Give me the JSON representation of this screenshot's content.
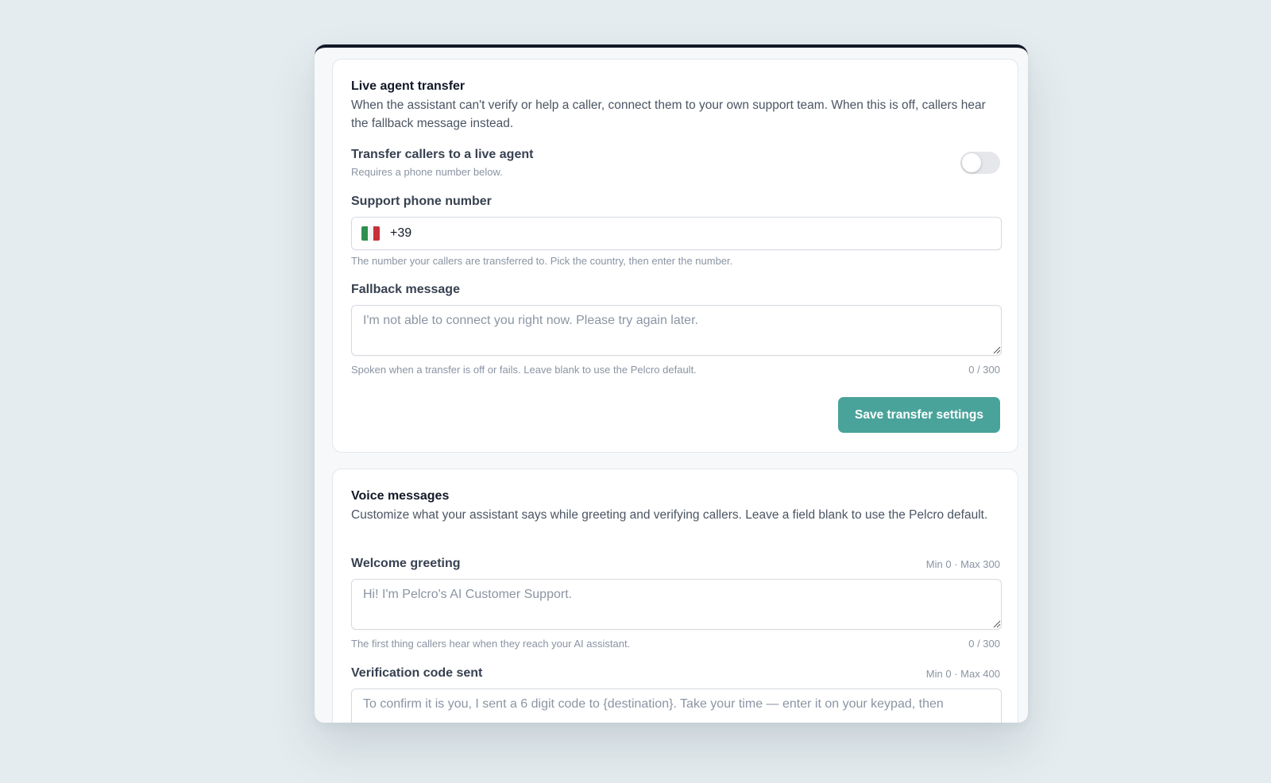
{
  "transfer": {
    "title": "Live agent transfer",
    "description": "When the assistant can't verify or help a caller, connect them to your own support team. When this is off, callers hear the fallback message instead.",
    "toggle_label": "Transfer callers to a live agent",
    "toggle_sublabel": "Requires a phone number below.",
    "toggle_on": false,
    "phone_label": "Support phone number",
    "phone_country": "Italy",
    "phone_value": "+39",
    "phone_helper": "The number your callers are transferred to. Pick the country, then enter the number.",
    "fallback_label": "Fallback message",
    "fallback_placeholder": "I'm not able to connect you right now. Please try again later.",
    "fallback_helper": "Spoken when a transfer is off or fails. Leave blank to use the Pelcro default.",
    "fallback_counter": "0 / 300",
    "save_label": "Save transfer settings"
  },
  "voice": {
    "title": "Voice messages",
    "description": "Customize what your assistant says while greeting and verifying callers. Leave a field blank to use the Pelcro default.",
    "welcome_label": "Welcome greeting",
    "welcome_limits": "Min 0 · Max 300",
    "welcome_placeholder": "Hi! I'm Pelcro's AI Customer Support.",
    "welcome_helper": "The first thing callers hear when they reach your AI assistant.",
    "welcome_counter": "0 / 300",
    "verification_label": "Verification code sent",
    "verification_limits": "Min 0 · Max 400",
    "verification_placeholder": "To confirm it is you, I sent a 6 digit code to {destination}. Take your time — enter it on your keypad, then"
  },
  "colors": {
    "accent": "#4aa39b",
    "page_bg": "#e4ecef",
    "panel_top_border": "#111827"
  }
}
